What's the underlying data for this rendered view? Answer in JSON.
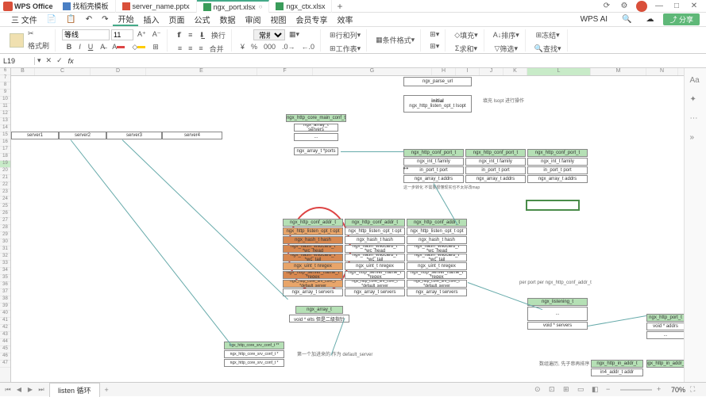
{
  "app": {
    "name": "WPS Office"
  },
  "tabs": [
    {
      "label": "找稻壳模板",
      "type": "doc"
    },
    {
      "label": "server_name.pptx",
      "type": "ppt"
    },
    {
      "label": "ngx_port.xlsx",
      "type": "xls",
      "active": true
    },
    {
      "label": "ngx_ctx.xlsx",
      "type": "xls"
    }
  ],
  "menu": {
    "file": "三 文件",
    "items": [
      "开始",
      "插入",
      "页面",
      "公式",
      "数据",
      "审阅",
      "视图",
      "会员专享",
      "效率"
    ],
    "active": "开始",
    "wps_ai": "WPS AI",
    "share": "分享"
  },
  "ribbon": {
    "format_painter": "格式刷",
    "font_name": "等线",
    "font_size": "11",
    "wrap": "换行",
    "merge": "合并",
    "general": "常规",
    "row_col": "行和列",
    "worksheet": "工作表",
    "cond_fmt": "条件格式",
    "fill": "填充",
    "sort": "排序",
    "freeze": "冻结",
    "sum": "求和",
    "filter": "筛选",
    "find": "查找"
  },
  "formula": {
    "cell_ref": "L19",
    "fx": "fx"
  },
  "cols": [
    "B",
    "C",
    "D",
    "E",
    "F",
    "G",
    "H",
    "I",
    "J",
    "K",
    "L",
    "M",
    "N"
  ],
  "rows_start": 6,
  "rows_end": 47,
  "diagram": {
    "servers": [
      "server1",
      "server2",
      "server3",
      "server4"
    ],
    "parse_url": "ngx_parse_url",
    "initial": "initial",
    "listen_opt": "ngx_http_listen_opt_t lsopt",
    "note1": "填充 lsopt 进行操作",
    "core_main": "ngx_http_core_main_conf_t",
    "arr_servers": "ngx_array_t servers",
    "arr_ports": "ngx_array_t *ports",
    "conf_port": "ngx_http_conf_port_t",
    "int_family": "ngx_int_t family",
    "port_t_port": "in_port_t port",
    "arr_addrs": "ngx_array_t addrs",
    "conv_info": "这一步转化 不需要很懂现实也不太好改map",
    "conf_addr": "ngx_http_conf_addr_t",
    "listen_opt_opt": "ngx_http_listen_opt_t opt",
    "hash_t_hash": "ngx_hash_t hash",
    "wc_head": "ngx_hash_wildcard_t *wc_head",
    "wc_tail": "ngx_hash_wildcard_t *wc_tail",
    "uint_nregex": "ngx_uint_t nregex",
    "srv_name_regex": "ngx_http_server_name_t *regex",
    "core_srv_def": "ngx_http_core_srv_conf_t *default_server",
    "arr_t_servers": "ngx_array_t servers",
    "arr_t": "ngx_array_t",
    "void_elts": "void * elts 但是二级指针",
    "core_srv_conf": "ngx_http_core_srv_conf_t **",
    "core_srv_h": "ngx_http_core_srv_conf_t *",
    "note_default": "第一个加进来的 作为 default_server",
    "listening": "ngx_listening_t",
    "void_servers": "void * servers",
    "note_perport": "per port per ngx_http_conf_addr_t",
    "note_sort": "数组遍历, 先子串再排序",
    "http_port": "ngx_http_port_t",
    "void_addrs": "void * addrs",
    "in_addr": "ngx_http_in_addr_t",
    "in_addr2": "ngx_http_in_addr_t",
    "addr_t_addr": "in4_addr_t addr"
  },
  "sheet_tab": {
    "name": "listen 循环"
  },
  "status": {
    "zoom": "70%"
  }
}
